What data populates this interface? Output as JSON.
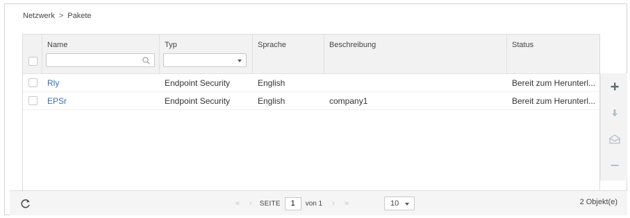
{
  "breadcrumb": {
    "root": "Netzwerk",
    "separator": ">",
    "current": "Pakete"
  },
  "columns": {
    "name": "Name",
    "type": "Typ",
    "language": "Sprache",
    "description": "Beschreibung",
    "status": "Status"
  },
  "filters": {
    "name_value": "",
    "type_value": ""
  },
  "rows": [
    {
      "name": "Rly",
      "type": "Endpoint Security",
      "language": "English",
      "description": "",
      "status": "Bereit zum Herunterl..."
    },
    {
      "name": "EPSr",
      "type": "Endpoint Security",
      "language": "English",
      "description": "company1",
      "status": "Bereit zum Herunterl..."
    }
  ],
  "pagination": {
    "first": "«",
    "prev": "‹",
    "page_label": "SEITE",
    "current_page": "1",
    "of_text": "von 1",
    "next": "›",
    "last": "»",
    "page_size": "10",
    "count_text": "2 Objekt(e)"
  },
  "icons": {
    "search": "search-icon",
    "refresh": "refresh-icon",
    "add": "plus-icon",
    "download": "download-arrow-icon",
    "send": "envelope-icon",
    "remove": "minus-icon"
  },
  "colors": {
    "link": "#3a6fb0",
    "header_bg": "#f2f2f2",
    "icon": "#5c6b73",
    "icon_disabled": "#b5bfc5"
  }
}
